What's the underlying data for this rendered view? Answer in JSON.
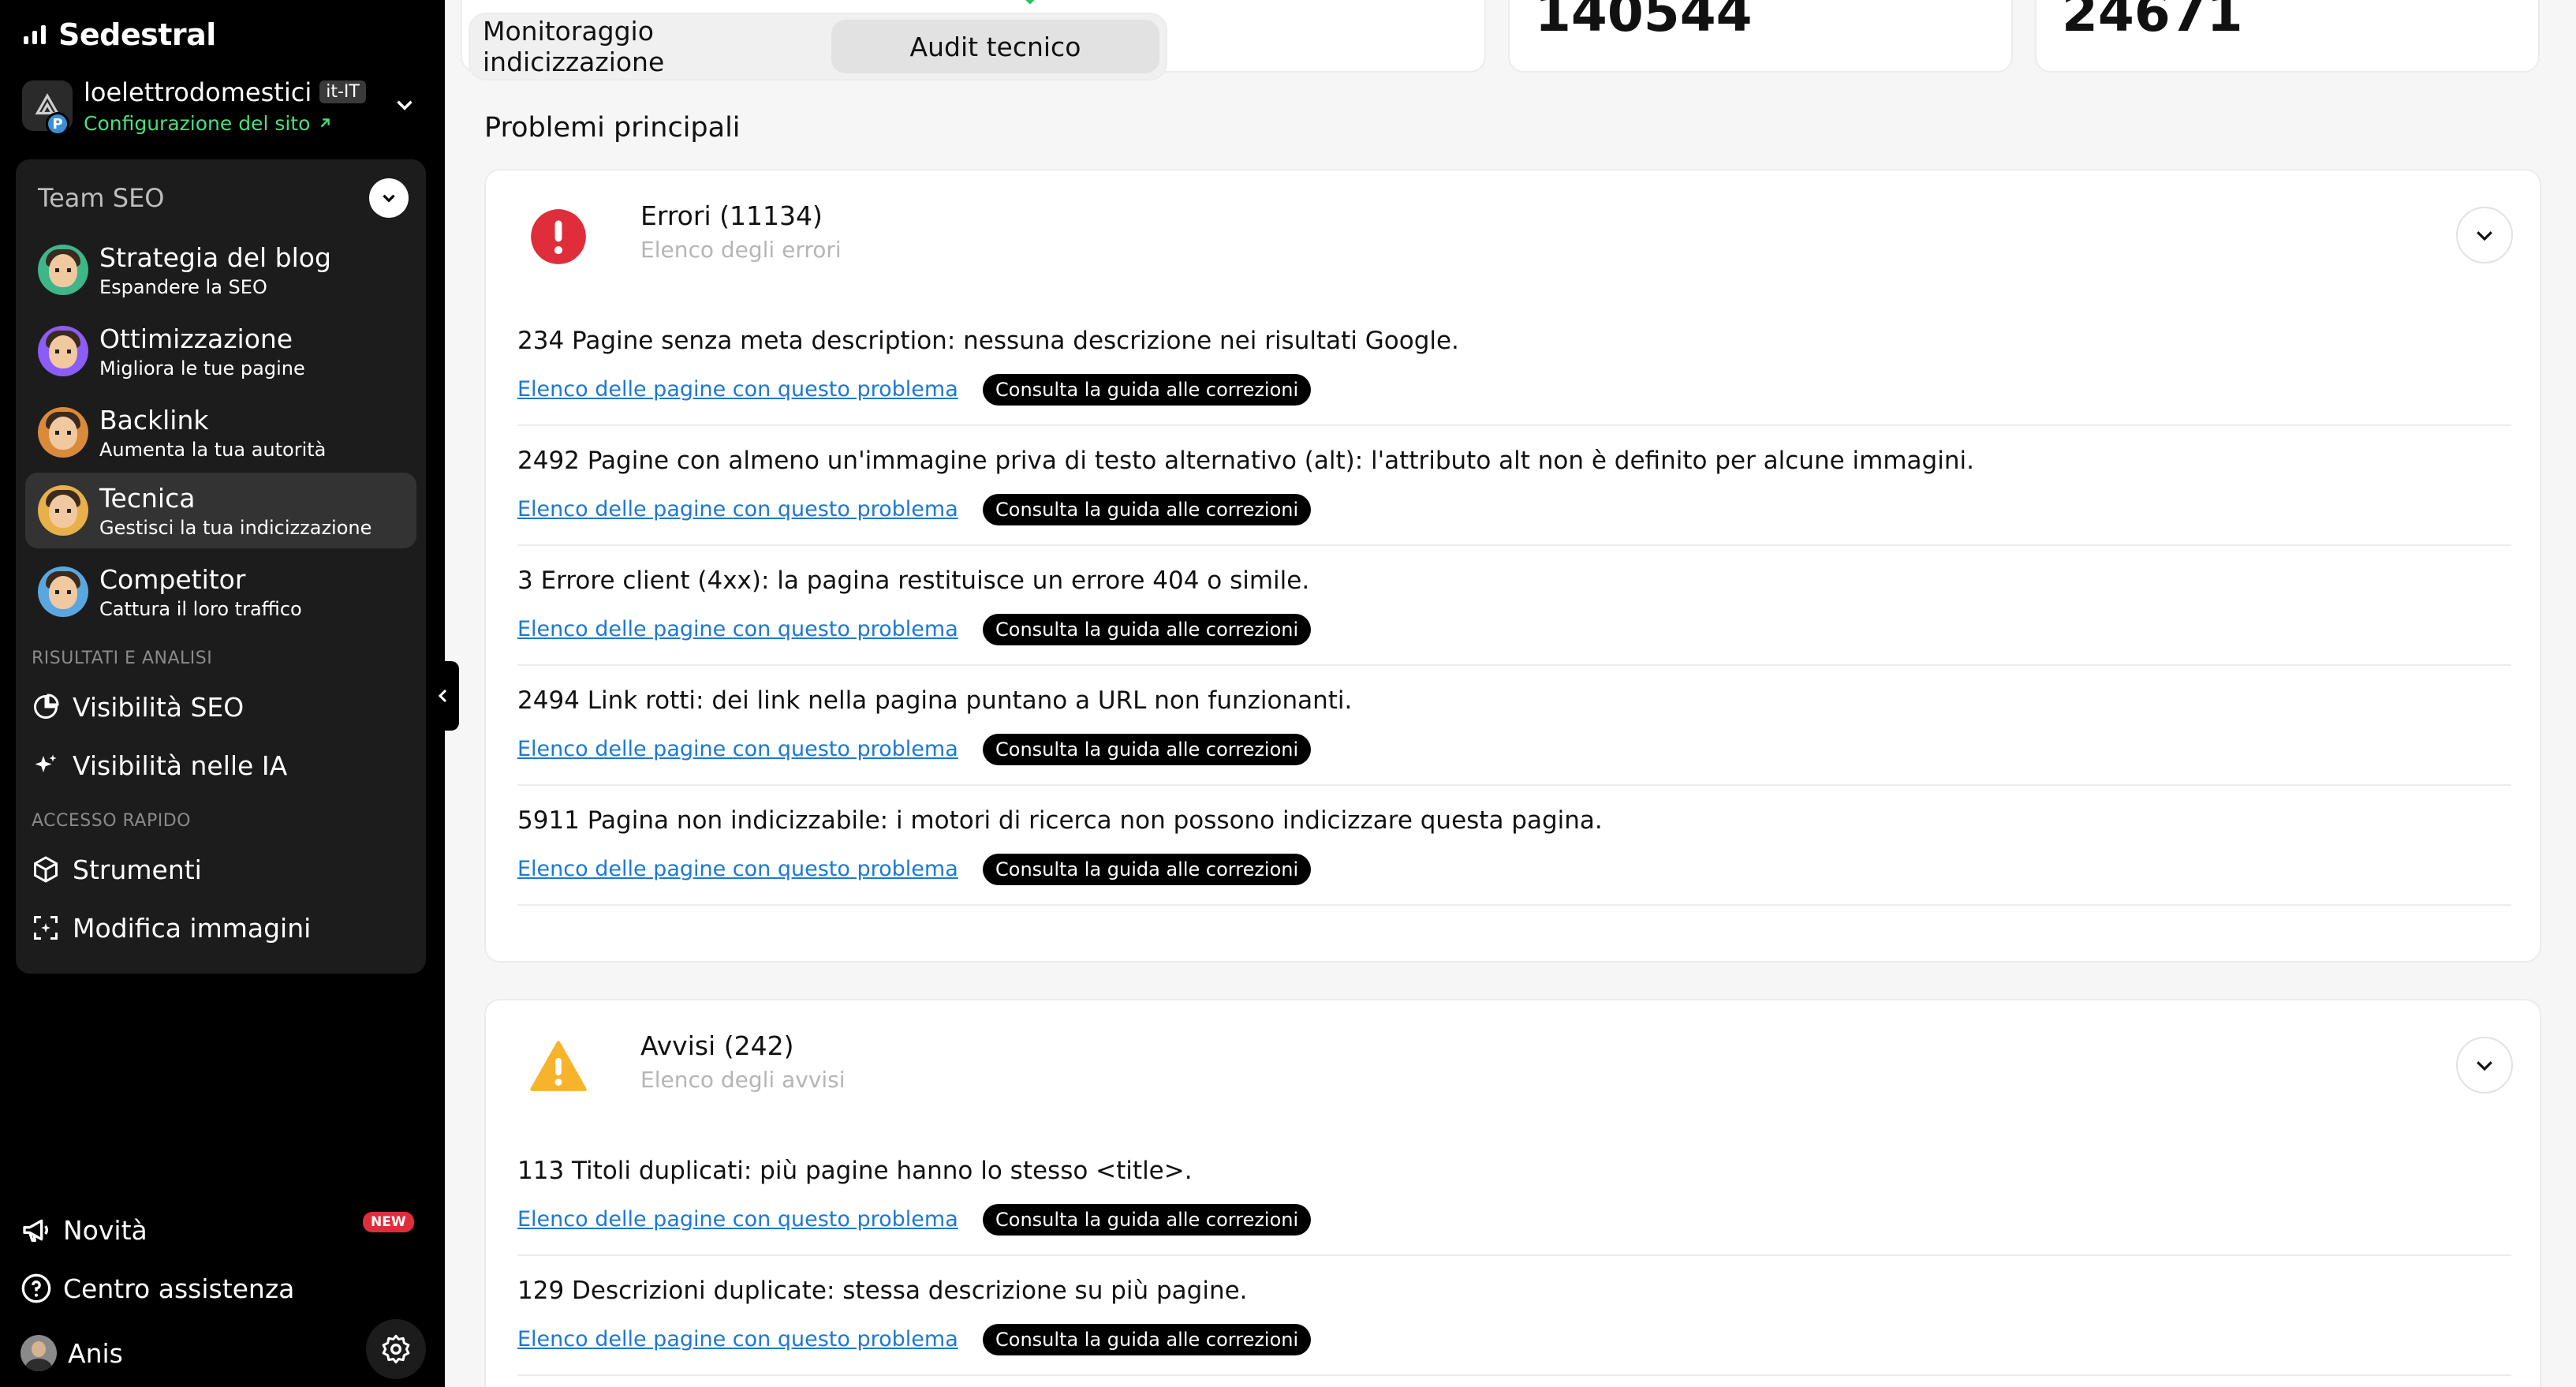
{
  "brand": {
    "name": "Sedestral"
  },
  "site": {
    "name": "loelettrodomestici",
    "lang": "it-IT",
    "config_label": "Configurazione del sito",
    "badge": "P"
  },
  "team": {
    "title": "Team SEO",
    "agents": [
      {
        "title": "Strategia del blog",
        "subtitle": "Espandere la SEO",
        "color": "#3fb58a"
      },
      {
        "title": "Ottimizzazione",
        "subtitle": "Migliora le tue pagine",
        "color": "#8b5cf6"
      },
      {
        "title": "Backlink",
        "subtitle": "Aumenta la tua autorità",
        "color": "#d98a3a"
      },
      {
        "title": "Tecnica",
        "subtitle": "Gestisci la tua indicizzazione",
        "color": "#e8b04a"
      },
      {
        "title": "Competitor",
        "subtitle": "Cattura il loro traffico",
        "color": "#5aa7e0"
      }
    ]
  },
  "results": {
    "label": "RISULTATI E ANALISI",
    "items": [
      {
        "label": "Visibilità SEO"
      },
      {
        "label": "Visibilità nelle IA"
      }
    ]
  },
  "quick": {
    "label": "ACCESSO RAPIDO",
    "items": [
      {
        "label": "Strumenti"
      },
      {
        "label": "Modifica immagini"
      }
    ]
  },
  "bottom": {
    "news": "Novità",
    "news_badge": "NEW",
    "help": "Centro assistenza",
    "user": "Anis"
  },
  "stats": [
    {
      "value": "140544"
    },
    {
      "value": "24671"
    }
  ],
  "tabs": {
    "monitor": "Monitoraggio indicizzazione",
    "audit": "Audit tecnico"
  },
  "heading": "Problemi principali",
  "errors": {
    "title": "Errori (11134)",
    "subtitle": "Elenco degli errori",
    "items": [
      {
        "text": "234 Pagine senza meta description: nessuna descrizione nei risultati Google.",
        "link": "Elenco delle pagine con questo problema",
        "guide": "Consulta la guida alle correzioni"
      },
      {
        "text": "2492 Pagine con almeno un'immagine priva di testo alternativo (alt): l'attributo alt non è definito per alcune immagini.",
        "link": "Elenco delle pagine con questo problema",
        "guide": "Consulta la guida alle correzioni"
      },
      {
        "text": "3 Errore client (4xx): la pagina restituisce un errore 404 o simile.",
        "link": "Elenco delle pagine con questo problema",
        "guide": "Consulta la guida alle correzioni"
      },
      {
        "text": "2494 Link rotti: dei link nella pagina puntano a URL non funzionanti.",
        "link": "Elenco delle pagine con questo problema",
        "guide": "Consulta la guida alle correzioni"
      },
      {
        "text": "5911 Pagina non indicizzabile: i motori di ricerca non possono indicizzare questa pagina.",
        "link": "Elenco delle pagine con questo problema",
        "guide": "Consulta la guida alle correzioni"
      }
    ]
  },
  "warnings": {
    "title": "Avvisi (242)",
    "subtitle": "Elenco degli avvisi",
    "items": [
      {
        "text": "113 Titoli duplicati: più pagine hanno lo stesso <title>.",
        "link": "Elenco delle pagine con questo problema",
        "guide": "Consulta la guida alle correzioni"
      },
      {
        "text": "129 Descrizioni duplicate: stessa descrizione su più pagine.",
        "link": "Elenco delle pagine con questo problema",
        "guide": "Consulta la guida alle correzioni"
      }
    ]
  },
  "colors": {
    "accent_green": "#4ade80",
    "error_red": "#e02d3c",
    "warning_yellow": "#f7b32b",
    "link_blue": "#1e78d2"
  }
}
